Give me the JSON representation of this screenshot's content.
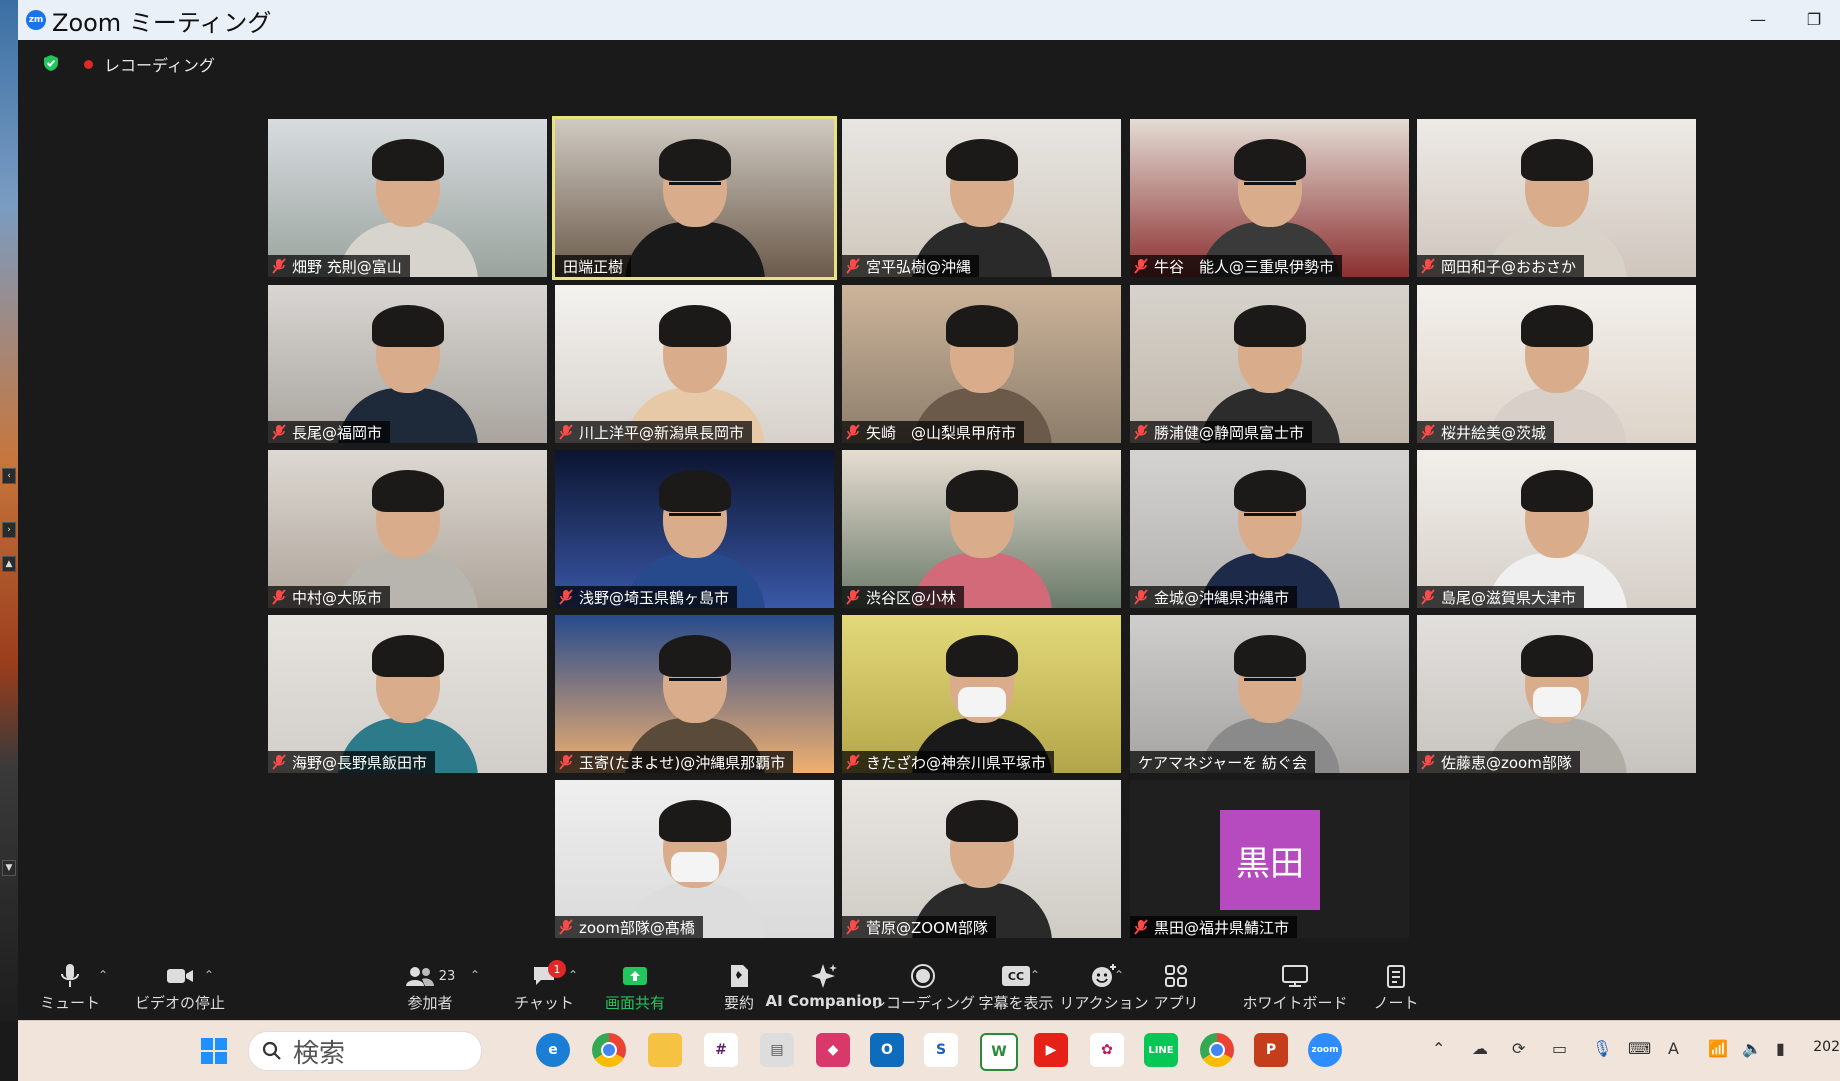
{
  "window": {
    "title": "Zoom ミーティング",
    "logo_text": "zm",
    "minimize": "—",
    "restore": "❐"
  },
  "meeting": {
    "recording_label": "レコーディング"
  },
  "participants": [
    {
      "name": "畑野 充則@富山",
      "muted": true
    },
    {
      "name": "田端正樹",
      "muted": false,
      "active_speaker": true
    },
    {
      "name": "宮平弘樹@沖縄",
      "muted": true
    },
    {
      "name": "牛谷　能人@三重県伊勢市",
      "muted": true
    },
    {
      "name": "岡田和子@おおさか",
      "muted": true
    },
    {
      "name": "長尾@福岡市",
      "muted": true
    },
    {
      "name": "川上洋平@新潟県長岡市",
      "muted": true
    },
    {
      "name": "矢崎　@山梨県甲府市",
      "muted": true
    },
    {
      "name": "勝浦健@静岡県富士市",
      "muted": true
    },
    {
      "name": "桜井絵美@茨城",
      "muted": true
    },
    {
      "name": "中村@大阪市",
      "muted": true
    },
    {
      "name": "浅野@埼玉県鶴ヶ島市",
      "muted": true
    },
    {
      "name": "渋谷区@小林",
      "muted": true
    },
    {
      "name": "金城@沖縄県沖縄市",
      "muted": true
    },
    {
      "name": "島尾@滋賀県大津市",
      "muted": true
    },
    {
      "name": "海野@長野県飯田市",
      "muted": true
    },
    {
      "name": "玉寄(たまよせ)@沖縄県那覇市",
      "muted": true
    },
    {
      "name": "きたざわ@神奈川県平塚市",
      "muted": true
    },
    {
      "name": "ケアマネジャーを 紡ぐ会",
      "muted": false
    },
    {
      "name": "佐藤恵@zoom部隊",
      "muted": true
    },
    {
      "name": "zoom部隊@髙橋",
      "muted": true
    },
    {
      "name": "菅原@ZOOM部隊",
      "muted": true
    },
    {
      "name": "黒田@福井県鯖江市",
      "muted": true,
      "avatar_text": "黒田"
    }
  ],
  "toolbar": {
    "mute": "ミュート",
    "stop_video": "ビデオの停止",
    "participants": "参加者",
    "participants_count": "23",
    "chat": "チャット",
    "chat_badge": "1",
    "share_screen": "画面共有",
    "summary": "要約",
    "ai_companion": "AI Companion",
    "recording": "レコーディング",
    "captions": "字幕を表示",
    "captions_icon": "CC",
    "reactions": "リアクション",
    "apps": "アプリ",
    "whiteboard": "ホワイトボード",
    "notes": "ノート"
  },
  "taskbar": {
    "search_label": "検索",
    "clock_fragment": "202",
    "apps": [
      "edge",
      "chrome",
      "explorer",
      "slack",
      "news",
      "office",
      "outlook",
      "sway",
      "word",
      "youtube",
      "photos",
      "line",
      "chrome-profile",
      "powerpoint",
      "zoom"
    ]
  },
  "colors": {
    "active_speaker": "#e8e37a",
    "share_green": "#22c55e",
    "muted_red": "#e02828",
    "avatar_purple": "#b64bc0"
  }
}
